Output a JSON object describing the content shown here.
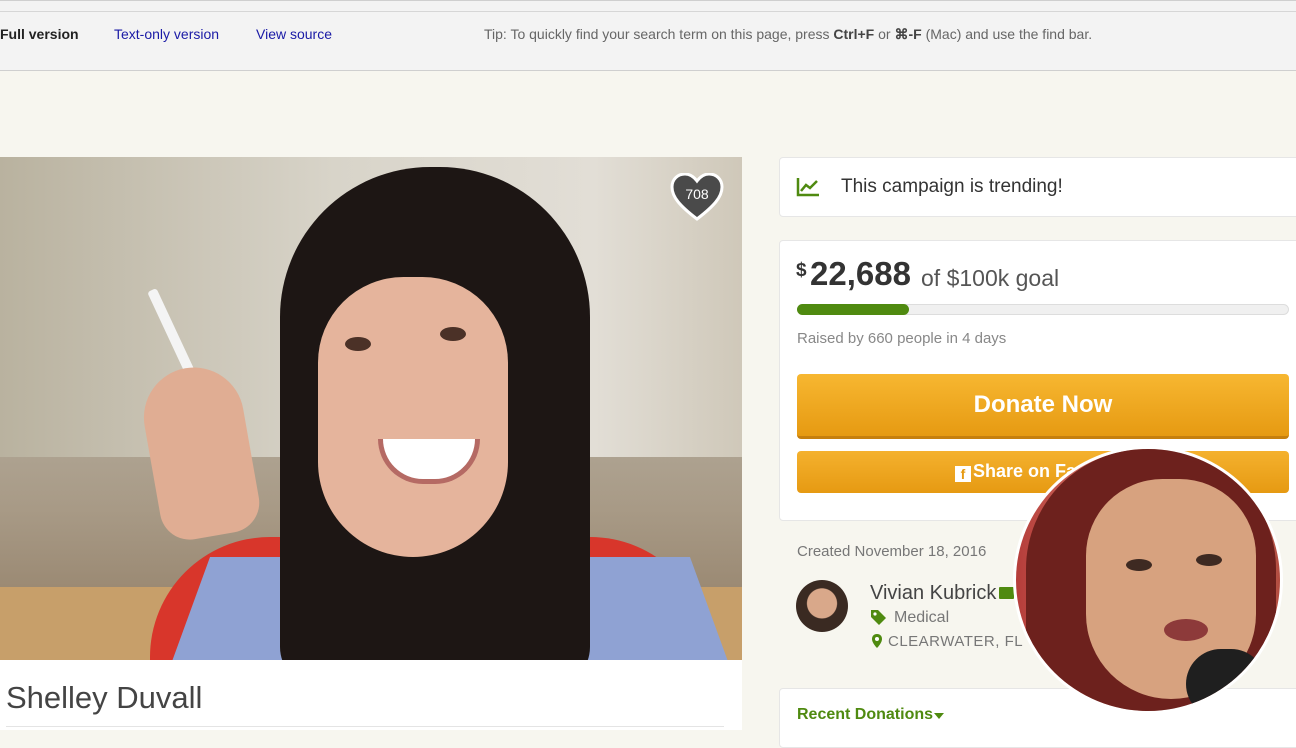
{
  "archive_bar": {
    "full_version": "Full version",
    "text_only": "Text-only version",
    "view_source": "View source",
    "tip_prefix": "Tip: To quickly find your search term on this page, press ",
    "tip_key1": "Ctrl+F",
    "tip_or": " or ",
    "tip_key2": "⌘-F",
    "tip_suffix": " (Mac) and use the find bar."
  },
  "campaign": {
    "title": "Shelley Duvall",
    "heart_count": "708",
    "trending": "This campaign is trending!",
    "currency": "$",
    "raised": "22,688",
    "goal_text": "of $100k goal",
    "progress_fraction": 0.227,
    "raised_by": "Raised by 660 people in 4 days",
    "donate_label": "Donate Now",
    "share_label": "Share on Fa",
    "created": "Created November 18, 2016",
    "organizer": "Vivian Kubrick",
    "category": "Medical",
    "location": "CLEARWATER, FL",
    "recent_donations": "Recent Donations"
  },
  "colors": {
    "accent_green": "#4f8a10",
    "donate_orange": "#f0a820",
    "link_blue": "#1a1aa6"
  },
  "icons": [
    "trending-icon",
    "heart-icon",
    "facebook-icon",
    "mail-icon",
    "tag-icon",
    "location-pin-icon",
    "caret-down-icon"
  ]
}
